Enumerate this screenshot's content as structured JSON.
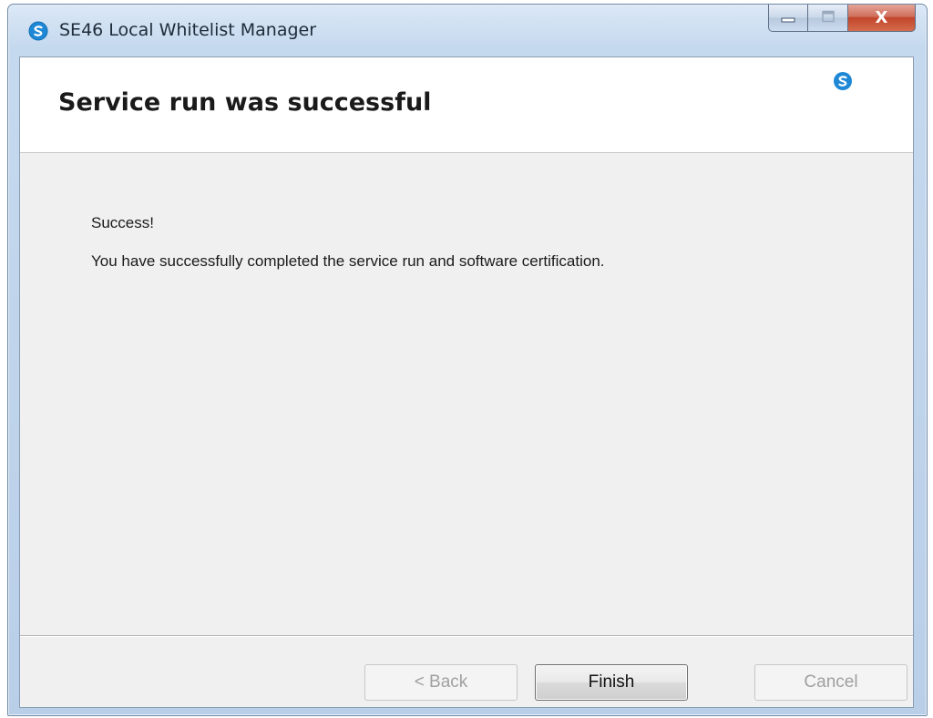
{
  "window": {
    "title": "SE46 Local Whitelist Manager",
    "icon": "app-logo-icon",
    "minimize_icon": "minimize-icon",
    "maximize_icon": "maximize-icon",
    "close_label": "X"
  },
  "header": {
    "title": "Service run was successful",
    "logo": "app-logo-icon"
  },
  "content": {
    "success_label": "Success!",
    "message": "You have successfully completed the service run and software certification."
  },
  "buttons": {
    "back_label": "< Back",
    "finish_label": "Finish",
    "cancel_label": "Cancel"
  },
  "colors": {
    "logo_blue": "#1e88d6",
    "close_red": "#c7462c",
    "client_bg": "#f0f0f0"
  }
}
